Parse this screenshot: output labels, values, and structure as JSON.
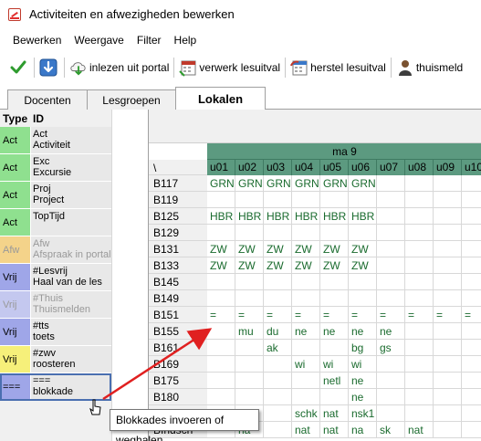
{
  "window": {
    "title": "Activiteiten en afwezigheden bewerken"
  },
  "menu": [
    "Bewerken",
    "Weergave",
    "Filter",
    "Help"
  ],
  "toolbar": {
    "import_label": "inlezen uit portal",
    "process_label": "verwerk lesuitval",
    "restore_label": "herstel lesuitval",
    "home_label": "thuismeld"
  },
  "tabs": [
    "Docenten",
    "Lesgroepen",
    "Lokalen"
  ],
  "left_panel": {
    "header_type": "Type",
    "header_id": "ID",
    "rows": [
      {
        "type": "Act",
        "code": "Act",
        "name": "Activiteit",
        "color": "#8fe08f",
        "dim": false
      },
      {
        "type": "Act",
        "code": "Exc",
        "name": "Excursie",
        "color": "#8fe08f",
        "dim": false
      },
      {
        "type": "Act",
        "code": "Proj",
        "name": "Project",
        "color": "#8fe08f",
        "dim": false
      },
      {
        "type": "Act",
        "code": "TopTijd",
        "name": "",
        "color": "#8fe08f",
        "dim": false
      },
      {
        "type": "Afw",
        "code": "Afw",
        "name": "Afspraak in portal",
        "color": "#f4d38a",
        "dim": true
      },
      {
        "type": "Vrij",
        "code": "#Lesvrij",
        "name": "Haal van de les",
        "color": "#9fa6e8",
        "dim": false
      },
      {
        "type": "Vrij",
        "code": "#Thuis",
        "name": "Thuismelden",
        "color": "#c4c8ef",
        "dim": true
      },
      {
        "type": "Vrij",
        "code": "#tts",
        "name": "toets",
        "color": "#9fa6e8",
        "dim": false
      },
      {
        "type": "Vrij",
        "code": "#zwv",
        "name": "roosteren",
        "color": "#f6f07a",
        "dim": false
      },
      {
        "type": "===",
        "code": "===",
        "name": "blokkade",
        "color": "#9fa6e8",
        "dim": false
      }
    ]
  },
  "grid": {
    "day": "ma 9",
    "corner": "\\",
    "slots": [
      "u01",
      "u02",
      "u03",
      "u04",
      "u05",
      "u06",
      "u07",
      "u08",
      "u09",
      "u10"
    ],
    "rows": [
      {
        "room": "B117",
        "cells": [
          "GRN",
          "GRN",
          "GRN",
          "GRN",
          "GRN",
          "GRN",
          "",
          "",
          "",
          ""
        ]
      },
      {
        "room": "B119",
        "cells": [
          "",
          "",
          "",
          "",
          "",
          "",
          "",
          "",
          "",
          ""
        ]
      },
      {
        "room": "B125",
        "cells": [
          "HBR",
          "HBR",
          "HBR",
          "HBR",
          "HBR",
          "HBR",
          "",
          "",
          "",
          ""
        ]
      },
      {
        "room": "B129",
        "cells": [
          "",
          "",
          "",
          "",
          "",
          "",
          "",
          "",
          "",
          ""
        ]
      },
      {
        "room": "B131",
        "cells": [
          "ZW",
          "ZW",
          "ZW",
          "ZW",
          "ZW",
          "ZW",
          "",
          "",
          "",
          ""
        ]
      },
      {
        "room": "B133",
        "cells": [
          "ZW",
          "ZW",
          "ZW",
          "ZW",
          "ZW",
          "ZW",
          "",
          "",
          "",
          ""
        ]
      },
      {
        "room": "B145",
        "cells": [
          "",
          "",
          "",
          "",
          "",
          "",
          "",
          "",
          "",
          ""
        ]
      },
      {
        "room": "B149",
        "cells": [
          "",
          "",
          "",
          "",
          "",
          "",
          "",
          "",
          "",
          ""
        ]
      },
      {
        "room": "B151",
        "cells": [
          "=",
          "=",
          "=",
          "=",
          "=",
          "=",
          "=",
          "=",
          "=",
          "="
        ]
      },
      {
        "room": "B155",
        "cells": [
          "",
          "mu",
          "du",
          "ne",
          "ne",
          "ne",
          "ne",
          "",
          "",
          ""
        ]
      },
      {
        "room": "B161",
        "cells": [
          "",
          "",
          "ak",
          "",
          "",
          "bg",
          "gs",
          "",
          "",
          ""
        ]
      },
      {
        "room": "B169",
        "cells": [
          "",
          "",
          "",
          "wi",
          "wi",
          "wi",
          "",
          "",
          "",
          ""
        ]
      },
      {
        "room": "B175",
        "cells": [
          "",
          "",
          "",
          "",
          "netl",
          "ne",
          "",
          "",
          "",
          ""
        ]
      },
      {
        "room": "B180",
        "cells": [
          "",
          "",
          "",
          "",
          "",
          "ne",
          "",
          "",
          "",
          ""
        ]
      },
      {
        "room": "",
        "cells": [
          "",
          "k",
          "",
          "schk",
          "nat",
          "nsk1",
          "",
          "",
          "",
          ""
        ]
      },
      {
        "room": "BIndsch",
        "cells": [
          "",
          "na",
          "",
          "nat",
          "nat",
          "na",
          "sk",
          "nat",
          "",
          ""
        ]
      }
    ]
  },
  "tooltip": {
    "text": "Blokkades invoeren of weghalen"
  }
}
